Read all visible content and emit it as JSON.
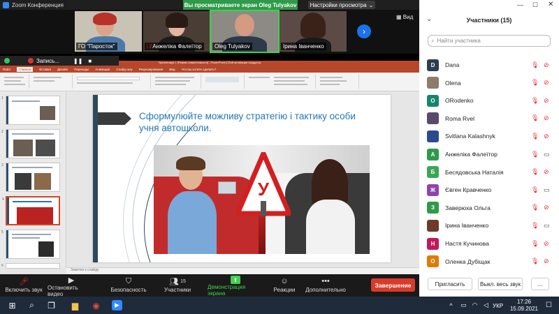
{
  "window": {
    "app_title": "Zoom Конференция",
    "share_banner": "Вы просматриваете экран Oleg Tulyakov",
    "view_settings": "Настройки просмотра",
    "view_label": "Вид"
  },
  "video_tiles": [
    {
      "name": "ГО \"Паросток\""
    },
    {
      "name": "Анжеліка Фалеїтор"
    },
    {
      "name": "Oleg Tulyakov"
    },
    {
      "name": "Ірина Іванченко"
    }
  ],
  "recording": {
    "label": "Запись..."
  },
  "ppt": {
    "title_bar": "Презентація 1 [Режим совместимости] - PowerPoint (Сбой активации продукта)",
    "tabs": [
      "Файл",
      "Главная",
      "Вставка",
      "Дизайн",
      "Переходы",
      "Анимация",
      "Слайд-шоу",
      "Рецензирование",
      "Вид",
      "Что вы хотите сделать?"
    ],
    "active_tab": 1,
    "slide_title": "Сформулюйте можливу стратегію і тактику особи учня автошколи.",
    "sign_letter": "У",
    "notes_hint": "Заметки к слайду"
  },
  "thumbnails": [
    1,
    2,
    3,
    4,
    5,
    6
  ],
  "controls": [
    {
      "label": "Включить звук",
      "icon": "🎤"
    },
    {
      "label": "Остановить видео",
      "icon": "📹"
    },
    {
      "label": "Безопасность",
      "icon": "🛡"
    },
    {
      "label": "Участники",
      "icon": "👥",
      "count": "15"
    },
    {
      "label": "Демонстрация экрана",
      "icon": "⬆"
    },
    {
      "label": "Реакции",
      "icon": "😀"
    },
    {
      "label": "Дополнительно",
      "icon": "•••"
    }
  ],
  "end_button": "Завершение",
  "panel": {
    "title": "Участники (15)",
    "search_placeholder": "Найти участника",
    "participants": [
      {
        "name": "Dana",
        "initial": "D",
        "color": "#2c3e50",
        "cam_off": true
      },
      {
        "name": "Olena",
        "initial": "",
        "color": "#8d7b6b",
        "cam_off": true
      },
      {
        "name": "ORodenko",
        "initial": "O",
        "color": "#14866d",
        "cam_off": true
      },
      {
        "name": "Roma Rvel",
        "initial": "",
        "color": "#5a4a6a",
        "cam_off": true
      },
      {
        "name": "Svitlana Kalashnyk",
        "initial": "",
        "color": "#2b4c8c",
        "cam_off": true
      },
      {
        "name": "Анжеліка Фалеїтор",
        "initial": "А",
        "color": "#2f9a4a",
        "cam_off": false
      },
      {
        "name": "Бесядовська Наталія",
        "initial": "Б",
        "color": "#3aa655",
        "cam_off": true
      },
      {
        "name": "Євген Кравченко",
        "initial": "Ж",
        "color": "#8e44ad",
        "cam_off": false
      },
      {
        "name": "Заверюха Ольга",
        "initial": "З",
        "color": "#2f9a4a",
        "cam_off": true
      },
      {
        "name": "Ірина Іванченко",
        "initial": "",
        "color": "#6b3b2b",
        "cam_off": false
      },
      {
        "name": "Настя Кучинова",
        "initial": "Н",
        "color": "#c2185b",
        "cam_off": true
      },
      {
        "name": "Оленка Дубіщак",
        "initial": "О",
        "color": "#e07b00",
        "cam_off": true
      }
    ],
    "invite_button": "Пригласить",
    "mute_all_button": "Выкл. весь звук",
    "more_button": "..."
  },
  "taskbar": {
    "language": "УКР",
    "time": "17:26",
    "date": "15.09.2021"
  },
  "colors": {
    "accent_green": "#3fd14a",
    "end_red": "#d93b2b",
    "ppt_orange": "#b7472a",
    "slide_title_blue": "#2577b5"
  }
}
